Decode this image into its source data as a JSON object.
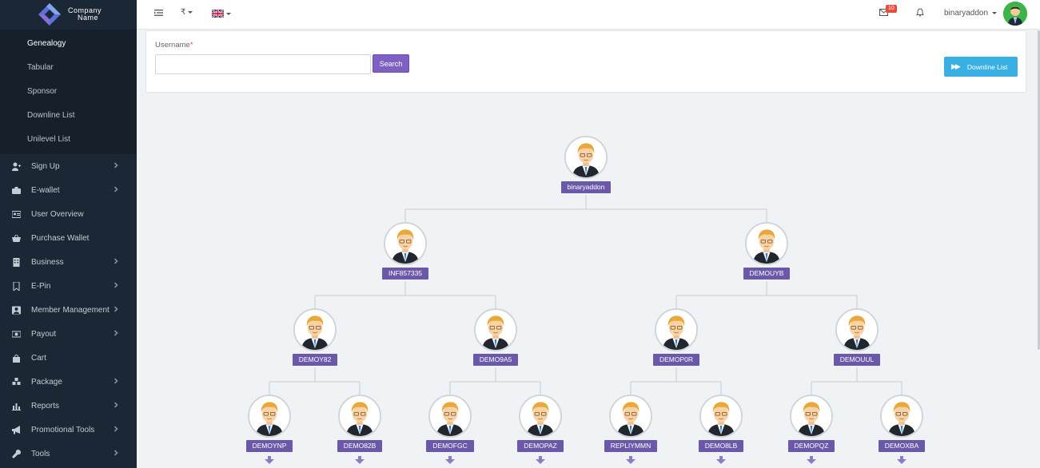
{
  "brand": {
    "line1": "Company",
    "line2": "Name"
  },
  "sidebar": {
    "submenu": [
      {
        "label": "Genealogy",
        "active": true
      },
      {
        "label": "Tabular"
      },
      {
        "label": "Sponsor"
      },
      {
        "label": "Downline List"
      },
      {
        "label": "Unilevel List"
      }
    ],
    "items": [
      {
        "label": "Sign Up",
        "icon": "user-plus-icon",
        "chevron": true
      },
      {
        "label": "E-wallet",
        "icon": "briefcase-icon",
        "chevron": true
      },
      {
        "label": "User Overview",
        "icon": "id-card-icon",
        "chevron": false
      },
      {
        "label": "Purchase Wallet",
        "icon": "basket-icon",
        "chevron": false
      },
      {
        "label": "Business",
        "icon": "building-icon",
        "chevron": true
      },
      {
        "label": "E-Pin",
        "icon": "bookmark-icon",
        "chevron": true
      },
      {
        "label": "Member Management",
        "icon": "member-icon",
        "chevron": true
      },
      {
        "label": "Payout",
        "icon": "money-icon",
        "chevron": true
      },
      {
        "label": "Cart",
        "icon": "bag-icon",
        "chevron": false
      },
      {
        "label": "Package",
        "icon": "cubes-icon",
        "chevron": true
      },
      {
        "label": "Reports",
        "icon": "bar-chart-icon",
        "chevron": true
      },
      {
        "label": "Promotional Tools",
        "icon": "bullhorn-icon",
        "chevron": true
      },
      {
        "label": "Tools",
        "icon": "wrench-icon",
        "chevron": true
      }
    ]
  },
  "topbar": {
    "currency": "₹",
    "mail_count": "10",
    "username": "binaryaddon"
  },
  "search": {
    "label": "Username",
    "required_mark": "*",
    "value": "",
    "button": "Search",
    "downline_button": "Downline List"
  },
  "tree": {
    "root": "binaryaddon",
    "level1": [
      "INF857335",
      "DEMOUYB"
    ],
    "level2": [
      "DEMOY82",
      "DEMO9A5",
      "DEMOP0R",
      "DEMOUUL"
    ],
    "level3": [
      "DEMOYNP",
      "DEMO82B",
      "DEMOFGC",
      "DEMOPAZ",
      "REPLIYMMN",
      "DEMO8LB",
      "DEMOPQZ",
      "DEMOXBA"
    ]
  },
  "colors": {
    "sidebar_bg": "#1b2734",
    "accent_purple": "#7d60c2",
    "name_badge": "#6b58a8",
    "downline_blue": "#39b0e3"
  }
}
